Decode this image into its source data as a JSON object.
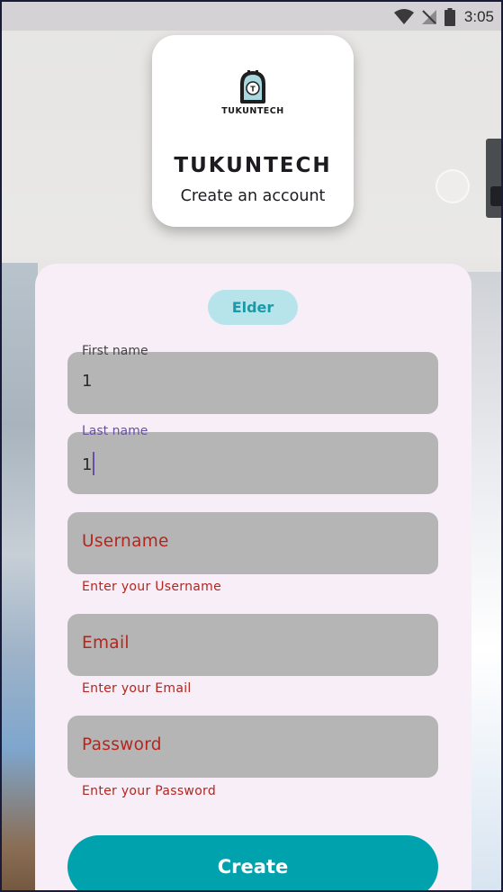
{
  "status_bar": {
    "time": "3:05",
    "icons": [
      "wifi-icon",
      "no-signal-icon",
      "battery-icon"
    ]
  },
  "header": {
    "logo_text": "TUKUNTECH",
    "logo_badge": "T",
    "title": "TUKUNTECH",
    "subtitle": "Create an account"
  },
  "form": {
    "role_chip": "Elder",
    "first_name": {
      "label": "First name",
      "value": "1"
    },
    "last_name": {
      "label": "Last name",
      "value": "1"
    },
    "username": {
      "placeholder": "Username",
      "error": "Enter your Username"
    },
    "email": {
      "placeholder": "Email",
      "error": "Enter your Email"
    },
    "password": {
      "placeholder": "Password",
      "error": "Enter your Password"
    },
    "create_label": "Create"
  },
  "colors": {
    "accent": "#00a3ad",
    "chip_bg": "#b7e4ea",
    "error": "#b3261e",
    "focus": "#6750a4",
    "field_bg": "#b5b5b5",
    "card_bg": "#f7eef7"
  }
}
